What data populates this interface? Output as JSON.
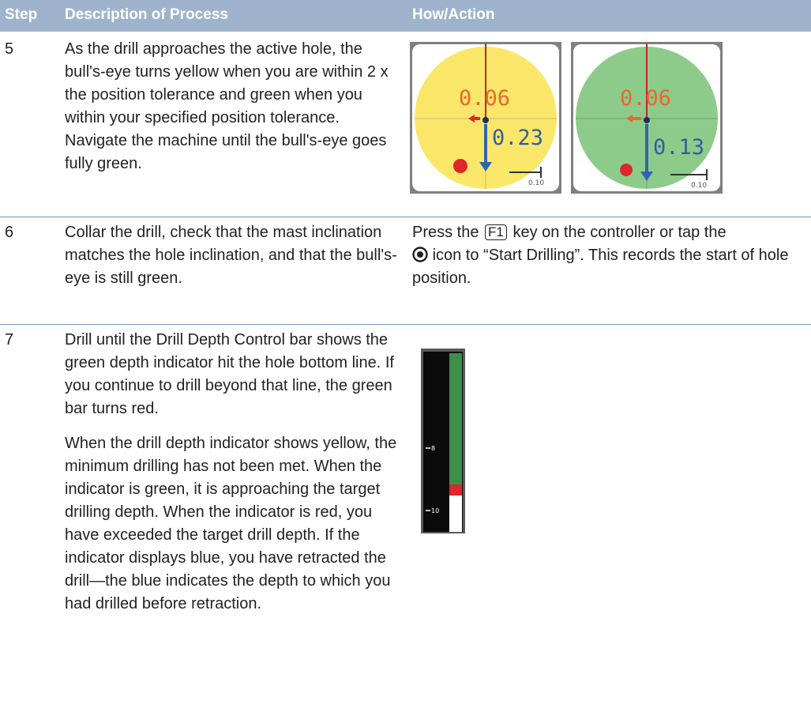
{
  "header": {
    "step": "Step",
    "description": "Description of Process",
    "how": "How/Action"
  },
  "rows": [
    {
      "step": "5",
      "description": "As the drill approaches the active hole, the bull's-eye turns yellow when you are within 2 x the position tolerance and green when you within your specified position tolerance. Navigate the machine until the bull's-eye goes fully green.",
      "bullseye_yellow": {
        "upper": "0.06",
        "lower": "0.23",
        "scale": "0.10",
        "fill": "#fae76a"
      },
      "bullseye_green": {
        "upper": "0.06",
        "lower": "0.13",
        "scale": "0.10",
        "fill": "#8dcb8a"
      }
    },
    {
      "step": "6",
      "description": "Collar the drill, check that the mast inclination matches the hole inclination, and that the bull's-eye is still green.",
      "how_pre": "Press the",
      "key": "F1",
      "how_mid": "key on the controller or tap the",
      "how_post": "icon to “Start Drilling”. This records the start of hole position."
    },
    {
      "step": "7",
      "description_p1": "Drill until the Drill Depth Control bar shows the green depth indicator hit the hole bottom line. If you continue to drill beyond that line, the green bar turns red.",
      "description_p2": "When the drill depth indicator shows yellow, the minimum drilling has not been met. When the indicator is green, it is approaching the target drilling depth. When the indicator is red, you have exceeded the target drill depth. If the indicator displays blue, you have retracted the drill—the blue indicates the depth to which you had drilled before retraction.",
      "depth_bar": {
        "tick_upper": "8",
        "tick_lower": "10"
      }
    }
  ],
  "colors": {
    "header_bg": "#9fb4cc",
    "rule": "#6f9ac4",
    "bullseye_yellow": "#fae76a",
    "bullseye_green": "#8dcb8a",
    "depth_green": "#3e8f4a",
    "depth_red": "#e0262a"
  }
}
